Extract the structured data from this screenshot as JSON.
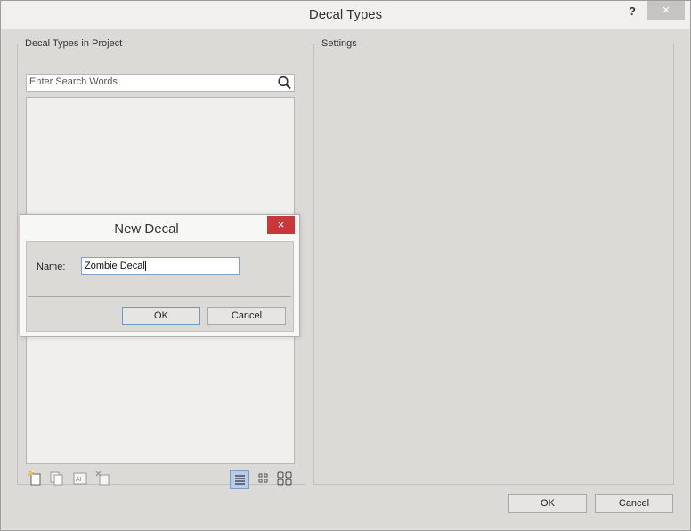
{
  "window": {
    "title": "Decal Types",
    "help_label": "?",
    "close_label": "×"
  },
  "left_panel": {
    "group_label": "Decal Types in Project",
    "search": {
      "placeholder": "Enter Search Words",
      "icon": "search-icon"
    },
    "toolbar_icons": [
      "new-decal-icon",
      "duplicate-icon",
      "rename-icon",
      "delete-icon"
    ],
    "view_buttons": [
      "list-view-icon",
      "small-grid-view-icon",
      "large-grid-view-icon"
    ]
  },
  "right_panel": {
    "group_label": "Settings"
  },
  "footer": {
    "ok_label": "OK",
    "cancel_label": "Cancel"
  },
  "modal": {
    "title": "New Decal",
    "close_label": "×",
    "name_label": "Name:",
    "name_value": "Zombie Decal",
    "ok_label": "OK",
    "cancel_label": "Cancel"
  },
  "colors": {
    "modal_close": "#c8383a",
    "active_view": "#b7cde6"
  }
}
